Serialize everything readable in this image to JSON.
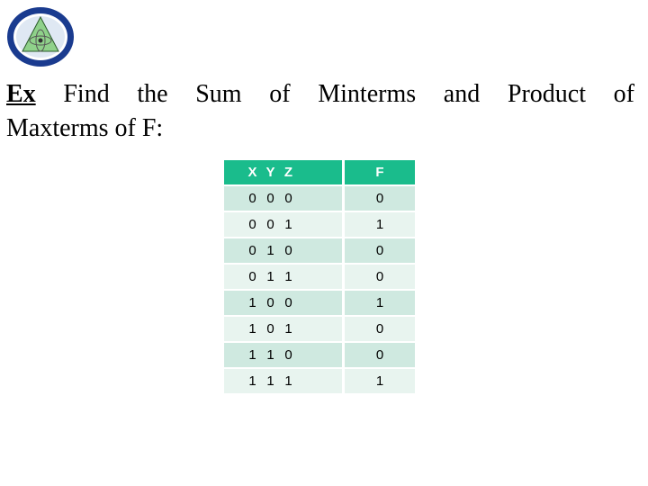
{
  "logo": {
    "icon": "university-seal-logo"
  },
  "heading": {
    "prefix": "Ex",
    "line1_words": [
      "Find",
      "the",
      "Sum",
      "of",
      "Minterms",
      "and",
      "Product",
      "of"
    ],
    "line2": "Maxterms of F:"
  },
  "truth_table": {
    "headers": {
      "inputs": [
        "X",
        "Y",
        "Z"
      ],
      "output": "F"
    },
    "rows": [
      {
        "inputs": [
          "0",
          "0",
          "0"
        ],
        "output": "0"
      },
      {
        "inputs": [
          "0",
          "0",
          "1"
        ],
        "output": "1"
      },
      {
        "inputs": [
          "0",
          "1",
          "0"
        ],
        "output": "0"
      },
      {
        "inputs": [
          "0",
          "1",
          "1"
        ],
        "output": "0"
      },
      {
        "inputs": [
          "1",
          "0",
          "0"
        ],
        "output": "1"
      },
      {
        "inputs": [
          "1",
          "0",
          "1"
        ],
        "output": "0"
      },
      {
        "inputs": [
          "1",
          "1",
          "0"
        ],
        "output": "0"
      },
      {
        "inputs": [
          "1",
          "1",
          "1"
        ],
        "output": "1"
      }
    ]
  },
  "colors": {
    "header_bg": "#1abc8c",
    "row_dark": "#cfe9e0",
    "row_light": "#e8f4ef"
  }
}
